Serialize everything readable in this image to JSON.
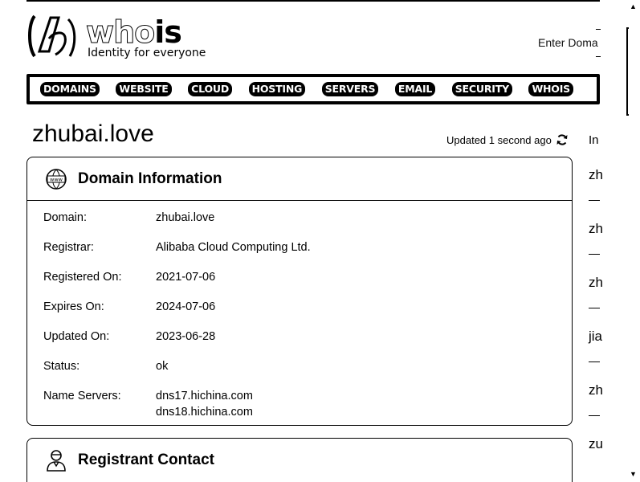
{
  "header": {
    "logo_word_a": "who",
    "logo_word_b": "is",
    "tagline": "Identity for everyone",
    "search_hint": "Enter Doma"
  },
  "nav": {
    "items": [
      "DOMAINS",
      "WEBSITE",
      "CLOUD",
      "HOSTING",
      "SERVERS",
      "EMAIL",
      "SECURITY",
      "WHOIS"
    ]
  },
  "page": {
    "title": "zhubai.love",
    "updated": "Updated 1 second ago"
  },
  "domain_card": {
    "title": "Domain Information",
    "icon": "www-globe-icon",
    "rows": [
      {
        "label": "Domain:",
        "value": "zhubai.love"
      },
      {
        "label": "Registrar:",
        "value": "Alibaba Cloud Computing Ltd."
      },
      {
        "label": "Registered On:",
        "value": "2021-07-06"
      },
      {
        "label": "Expires On:",
        "value": "2024-07-06"
      },
      {
        "label": "Updated On:",
        "value": "2023-06-28"
      },
      {
        "label": "Status:",
        "value": "ok"
      },
      {
        "label": "Name Servers:",
        "values": [
          "dns17.hichina.com",
          "dns18.hichina.com"
        ]
      }
    ]
  },
  "registrant_card": {
    "title": "Registrant Contact",
    "icon": "person-icon"
  },
  "sidebar": {
    "heading": "In",
    "items": [
      "zh",
      "zh",
      "zh",
      "jia",
      "zh",
      "zu"
    ]
  }
}
